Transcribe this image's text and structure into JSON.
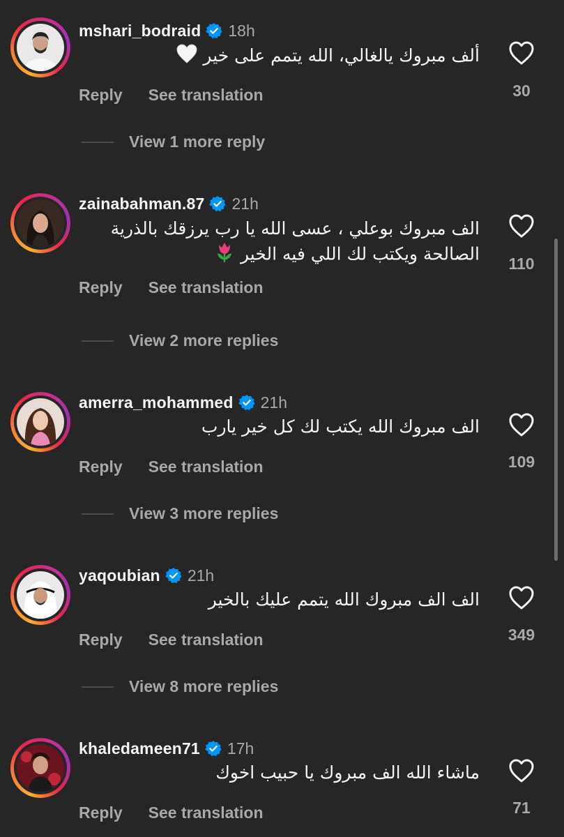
{
  "labels": {
    "reply": "Reply",
    "see_translation": "See translation"
  },
  "comments": [
    {
      "username": "mshari_bodraid",
      "time": "18h",
      "lines": [
        "ألف مبروك يالغالي، الله يتمم على خير"
      ],
      "emoji": "white-heart-icon",
      "likes": "30",
      "view_more": "View 1 more reply"
    },
    {
      "username": "zainabahman.87",
      "time": "21h",
      "lines": [
        "الف مبروك بوعلي ، عسى الله يا رب يرزقك بالذرية",
        "الصالحة ويكتب لك اللي فيه الخير"
      ],
      "emoji": "tulip-icon",
      "likes": "110",
      "view_more": "View 2 more replies"
    },
    {
      "username": "amerra_mohammed",
      "time": "21h",
      "lines": [
        "الف مبروك الله يكتب لك كل خير يارب"
      ],
      "likes": "109",
      "view_more": "View 3 more replies"
    },
    {
      "username": "yaqoubian",
      "time": "21h",
      "lines": [
        "الف الف مبروك الله يتمم عليك بالخير"
      ],
      "likes": "349",
      "view_more": "View 8 more replies"
    },
    {
      "username": "khaledameen71",
      "time": "17h",
      "lines": [
        "ماشاء الله الف مبروك يا حبيب اخوك"
      ],
      "likes": "71"
    }
  ],
  "icons": {
    "verified": "verified-badge-icon",
    "like": "heart-outline-icon"
  },
  "colors": {
    "background": "#262626",
    "text": "#f5f5f5",
    "muted": "#a8a8a8",
    "verified": "#0095f6"
  }
}
